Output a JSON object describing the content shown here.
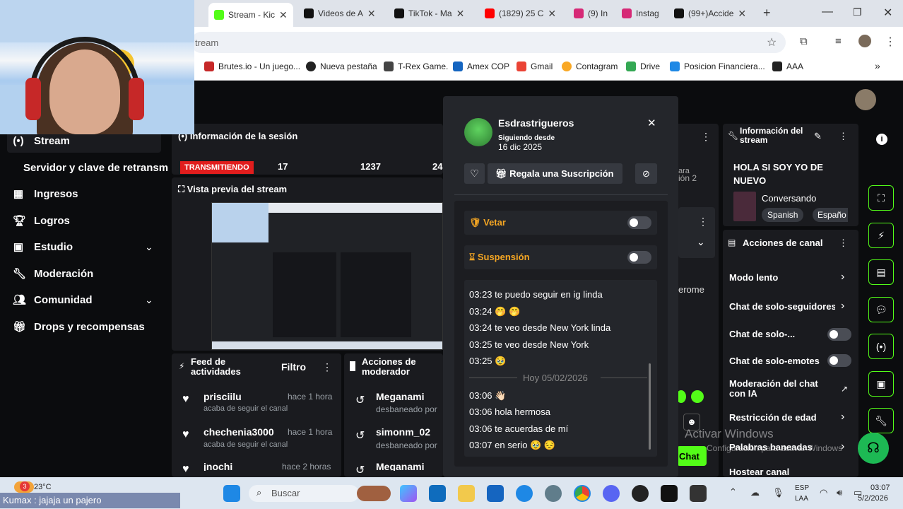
{
  "browser": {
    "tabs": [
      {
        "label": "Stream - Kic",
        "color": "#53fc18"
      },
      {
        "label": "Videos de A",
        "color": "#111"
      },
      {
        "label": "TikTok - Ma",
        "color": "#111"
      },
      {
        "label": "(1829) 25 C",
        "color": "#ff0000"
      },
      {
        "label": "(9) In",
        "color": "#d62976"
      },
      {
        "label": "Instag",
        "color": "#d62976"
      },
      {
        "label": "(99+)Accide",
        "color": "#111"
      }
    ],
    "url": "tream",
    "bookmarks": [
      {
        "label": "Brutes.io - Un juego...",
        "color": "#c62828"
      },
      {
        "label": "Nueva pestaña",
        "color": "#222"
      },
      {
        "label": "T-Rex Game.",
        "color": "#444"
      },
      {
        "label": "Amex COP",
        "color": "#1565c0"
      },
      {
        "label": "Gmail",
        "color": "#ea4335"
      },
      {
        "label": "Contagram",
        "color": "#f9a825"
      },
      {
        "label": "Drive",
        "color": "#34a853"
      },
      {
        "label": "Posicion Financiera...",
        "color": "#1e88e5"
      },
      {
        "label": "AAA",
        "color": "#222"
      }
    ]
  },
  "nav": {
    "stream": "Stream",
    "server_key": "Servidor y clave de retransm",
    "items": [
      "Ingresos",
      "Logros",
      "Estudio",
      "Moderación",
      "Comunidad",
      "Drops y recompensas"
    ]
  },
  "session": {
    "title": "Información de la sesión",
    "live": "TRANSMITIENDO",
    "stat1": "17",
    "stat2": "1237",
    "stat3": "24",
    "preview_title": "Vista previa del stream"
  },
  "feed": {
    "title": "Feed de actividades",
    "filter": "Filtro",
    "items": [
      {
        "user": "prisciilu",
        "time": "hace 1 hora",
        "action": "acaba de seguir el canal"
      },
      {
        "user": "chechenia3000",
        "time": "hace 1 hora",
        "action": "acaba de seguir el canal"
      },
      {
        "user": "jnochi",
        "time": "hace 2 horas",
        "action": ""
      }
    ]
  },
  "modactions": {
    "title": "Acciones de moderador",
    "items": [
      {
        "user": "Meganami",
        "action": "desbaneado por"
      },
      {
        "user": "simonm_02",
        "action": "desbaneado por"
      },
      {
        "user": "Meganami",
        "action": ""
      }
    ]
  },
  "popup": {
    "username": "Esdrastrigueros",
    "following_label": "Siguiendo desde",
    "following_date": "16 dic 2025",
    "gift": "Regala una Suscripción",
    "ban": "Vetar",
    "suspend": "Suspensión",
    "date_divider": "Hoy 05/02/2026",
    "messages": [
      {
        "time": "03:23",
        "text": "te puedo seguir en ig linda"
      },
      {
        "time": "03:24",
        "text": "🤭 🤭"
      },
      {
        "time": "03:24",
        "text": "te veo desde New York linda"
      },
      {
        "time": "03:25",
        "text": "te veo desde New York"
      },
      {
        "time": "03:25",
        "text": "🥹"
      },
      {
        "time": "03:06",
        "text": "👋🏻"
      },
      {
        "time": "03:06",
        "text": "hola hermosa"
      },
      {
        "time": "03:06",
        "text": "te acuerdas de mí"
      },
      {
        "time": "03:07",
        "text": "en serio 🥹 😔"
      }
    ]
  },
  "behind": {
    "ara": "ara",
    "ion2": "ión 2",
    "erome": "erome",
    "chat_btn": "Chat"
  },
  "streaminfo": {
    "title": "Información del stream",
    "stream_title": "HOLA SI SOY YO DE NUEVO",
    "category": "Conversando",
    "tag1": "Spanish",
    "tag2": "Españo"
  },
  "channel": {
    "title": "Acciones de canal",
    "rows": [
      "Modo lento",
      "Chat de solo-seguidores",
      "Chat de solo-...",
      "Chat de solo-emotes",
      "Moderación del chat con IA",
      "Restricción de edad",
      "Palabras baneadas",
      "Hostear canal"
    ]
  },
  "watermark": {
    "line1": "Activar Windows",
    "line2": "Configuración para activar Windows"
  },
  "taskbar": {
    "weather": "23°C",
    "notif": "3",
    "ticker": "Kumax : jajaja un pajero",
    "search": "Buscar",
    "lang": "ESP",
    "lang2": "LAA",
    "time": "03:07",
    "date": "5/2/2026"
  }
}
